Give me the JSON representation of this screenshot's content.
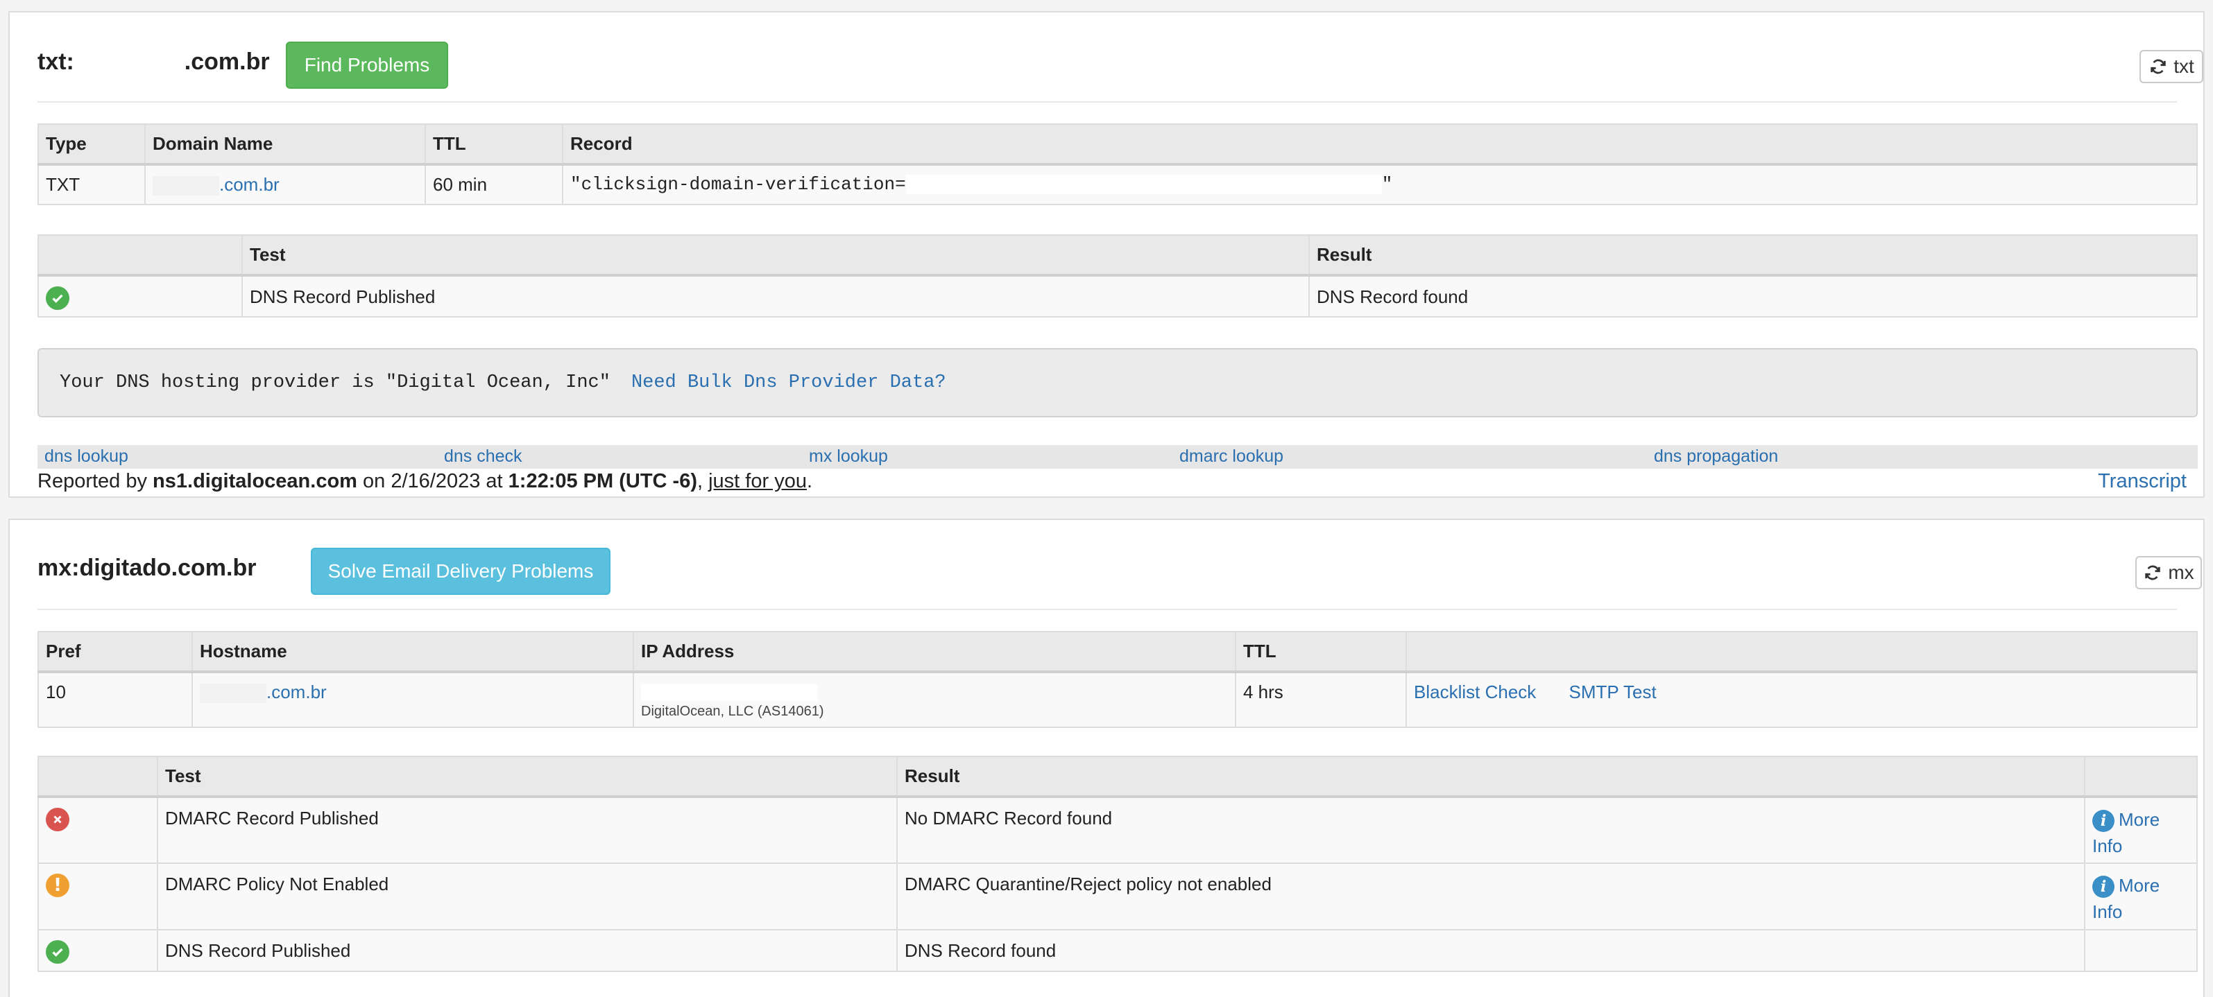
{
  "txt_section": {
    "title_prefix": "txt:",
    "title_domain": ".com.br",
    "find_button": "Find Problems",
    "refresh_label": "txt",
    "records_table": {
      "headers": [
        "Type",
        "Domain Name",
        "TTL",
        "Record"
      ],
      "row": {
        "type": "TXT",
        "domain": ".com.br",
        "ttl": "60 min",
        "record_prefix": "\"clicksign-domain-verification=",
        "record_suffix": "\""
      }
    },
    "test_table": {
      "headers": [
        "",
        "Test",
        "Result"
      ],
      "rows": [
        {
          "status": "ok",
          "test": "DNS Record Published",
          "result": "DNS Record found"
        }
      ]
    },
    "provider_text": "Your DNS hosting provider is \"Digital Ocean, Inc\"",
    "provider_link": "Need Bulk Dns Provider Data?",
    "links": [
      "dns lookup",
      "dns check",
      "mx lookup",
      "dmarc lookup",
      "dns propagation"
    ],
    "reported": {
      "prefix": "Reported by ",
      "server": "ns1.digitalocean.com",
      "on": " on 2/16/2023 at ",
      "time": "1:22:05 PM (UTC -6)",
      "comma": ", ",
      "just": "just for you",
      "period": "."
    },
    "transcript": "Transcript"
  },
  "mx_section": {
    "title": "mx:digitado.com.br",
    "solve_button": "Solve Email Delivery Problems",
    "refresh_label": "mx",
    "records_table": {
      "headers": [
        "Pref",
        "Hostname",
        "IP Address",
        "TTL",
        ""
      ],
      "row": {
        "pref": "10",
        "hostname": ".com.br",
        "ip_org": "DigitalOcean, LLC (AS14061)",
        "ttl": "4 hrs",
        "blacklist": "Blacklist Check",
        "smtp": "SMTP Test"
      }
    },
    "test_table": {
      "headers": [
        "",
        "Test",
        "Result",
        ""
      ],
      "rows": [
        {
          "status": "error",
          "test": "DMARC Record Published",
          "result": "No DMARC Record found",
          "more": "More Info"
        },
        {
          "status": "warning",
          "test": "DMARC Policy Not Enabled",
          "result": "DMARC Quarantine/Reject policy not enabled",
          "more": "More Info"
        },
        {
          "status": "ok",
          "test": "DNS Record Published",
          "result": "DNS Record found",
          "more": ""
        }
      ]
    }
  },
  "colors": {
    "green_button": "#5cb85c",
    "blue_button": "#5bc0de",
    "link": "#2a6fb0",
    "ok": "#4caf50",
    "error": "#d9534f",
    "warning": "#f0a030"
  }
}
